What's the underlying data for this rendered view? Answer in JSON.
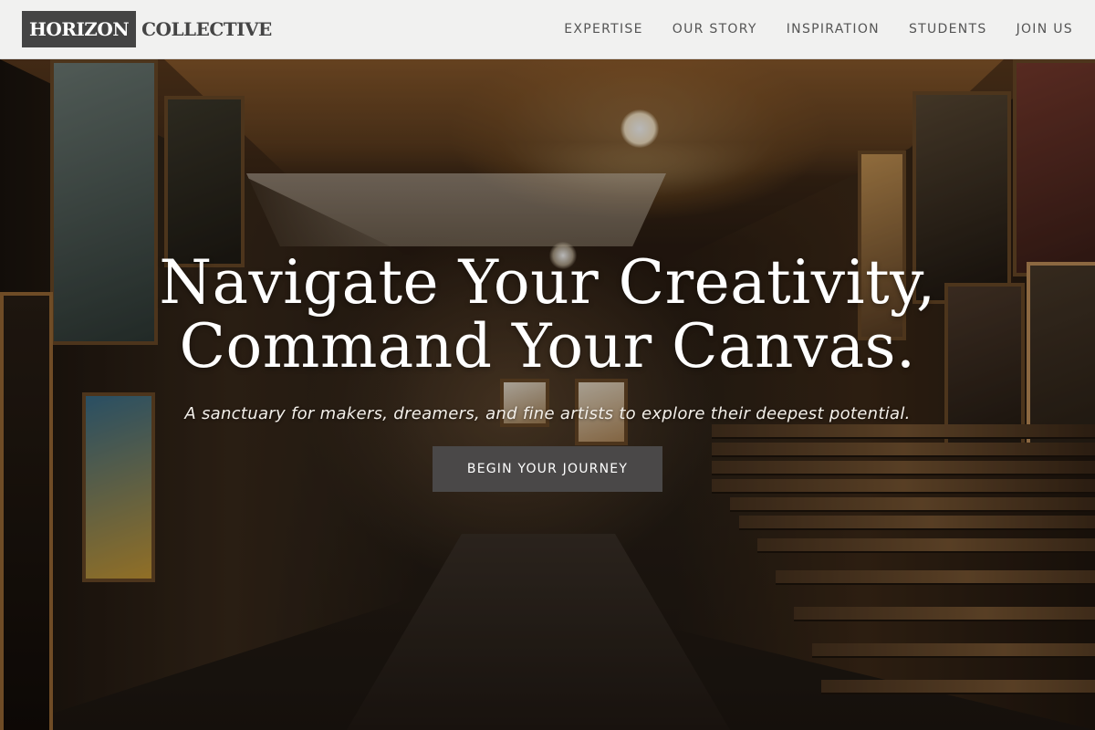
{
  "brand": {
    "logo_box_text": "HORIZON",
    "logo_rest_text": "COLLECTIVE"
  },
  "nav": {
    "items": [
      {
        "label": "EXPERTISE"
      },
      {
        "label": "OUR STORY"
      },
      {
        "label": "INSPIRATION"
      },
      {
        "label": "STUDENTS"
      },
      {
        "label": "JOIN US"
      }
    ]
  },
  "hero": {
    "headline_line1": "Navigate Your Creativity,",
    "headline_line2": "Command Your Canvas.",
    "subheadline": "A sanctuary for makers, dreamers, and fine artists to explore their deepest potential.",
    "cta_label": "BEGIN YOUR JOURNEY"
  },
  "colors": {
    "header_bg": "#f1f1f0",
    "logo_box_bg": "#444444",
    "nav_text": "#555555",
    "cta_bg": "#4a4848",
    "hero_text": "#ffffff"
  }
}
